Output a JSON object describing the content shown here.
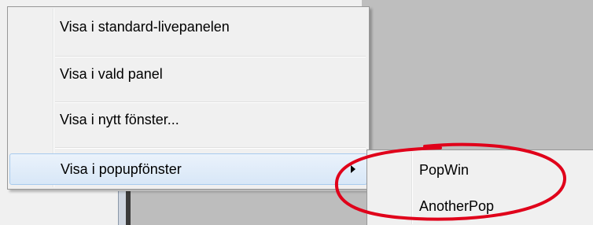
{
  "context_menu": {
    "items": [
      {
        "label": "Visa i standard-livepanelen"
      },
      {
        "label": "Visa i vald panel"
      },
      {
        "label": "Visa i nytt fönster..."
      },
      {
        "label": "Visa i popupfönster",
        "has_submenu": true,
        "highlighted": true
      }
    ]
  },
  "submenu": {
    "items": [
      {
        "label": "PopWin"
      },
      {
        "label": "AnotherPop"
      }
    ]
  },
  "colors": {
    "annotation": "#e0001a",
    "highlight_border": "#a8cbee",
    "menu_background": "#f0f0f0"
  },
  "icons": {
    "submenu_arrow": "chevron-right-icon"
  }
}
